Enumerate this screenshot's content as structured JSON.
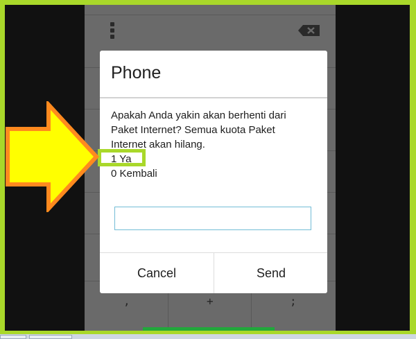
{
  "dialog": {
    "title": "Phone",
    "message_lines": [
      "Apakah Anda yakin akan berhenti dari",
      "Paket Internet? Semua kuota Paket",
      "Internet akan hilang.",
      "1 Ya",
      "0 Kembali"
    ],
    "input": {
      "value": "",
      "placeholder": ""
    },
    "buttons": {
      "cancel": "Cancel",
      "send": "Send"
    }
  },
  "dialer": {
    "menu_icon": "overflow-menu-icon",
    "backspace_icon": "backspace-icon",
    "bottom_keys": [
      ",",
      "+",
      ";"
    ]
  },
  "annotation": {
    "arrow_fill": "#ffff00",
    "arrow_stroke": "#ff8a1e",
    "highlight_color": "#a9d82a"
  }
}
